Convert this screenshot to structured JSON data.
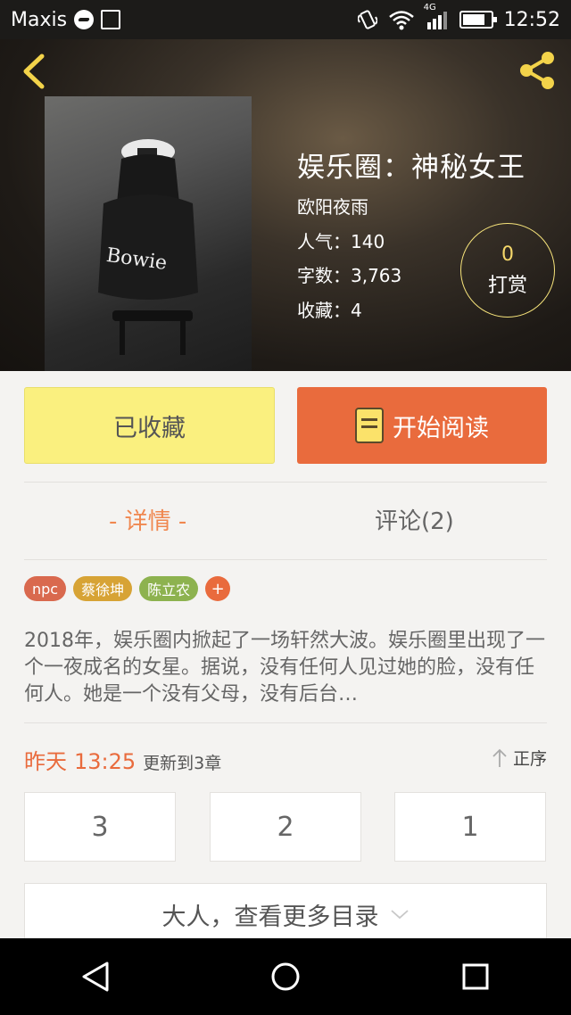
{
  "status_bar": {
    "carrier": "Maxis",
    "network": "4G",
    "time": "12:52"
  },
  "header": {
    "back_icon": "chevron-left-icon",
    "share_icon": "share-icon",
    "accent": "#f3d34a"
  },
  "book": {
    "title": "娱乐圈：神秘女王",
    "author": "欧阳夜雨",
    "popularity": "人气：140",
    "word_count": "字数：3,763",
    "favorites": "收藏：4",
    "cover_text": "Bowie"
  },
  "reward": {
    "count": "0",
    "label": "打赏",
    "color": "#f5d76a"
  },
  "actions": {
    "favorite_label": "已收藏",
    "read_label": "开始阅读",
    "read_color": "#e96b3d",
    "favorite_color": "#faf07f"
  },
  "tabs": {
    "detail": "- 详情 -",
    "comments": "评论(2)"
  },
  "tags": [
    {
      "label": "npc",
      "color": "#d9694e"
    },
    {
      "label": "蔡徐坤",
      "color": "#d7a335"
    },
    {
      "label": "陈立农",
      "color": "#8db24f"
    },
    {
      "label": "+",
      "color": "#e96b3d"
    }
  ],
  "description": "2018年，娱乐圈内掀起了一场轩然大波。娱乐圈里出现了一个一夜成名的女星。据说，没有任何人见过她的脸，没有任何人。她是一个没有父母，没有后台…",
  "update": {
    "when": "昨天",
    "time": "13:25",
    "text": "更新到3章"
  },
  "sort_label": "正序",
  "chapters": [
    "3",
    "2",
    "1"
  ],
  "more_catalog": "大人，查看更多目录"
}
